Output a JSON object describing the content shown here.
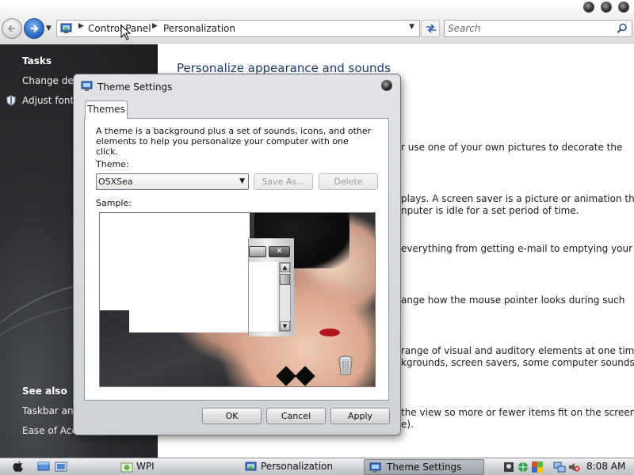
{
  "address_bar": {
    "breadcrumbs": [
      "Control Panel",
      "Personalization"
    ]
  },
  "search": {
    "placeholder": "Search"
  },
  "sidebar": {
    "tasks_heading": "Tasks",
    "tasks": [
      "Change desi",
      "Adjust font s"
    ],
    "see_also_heading": "See also",
    "see_also": [
      "Taskbar and",
      "Ease of Acce"
    ]
  },
  "main": {
    "title": "Personalize appearance and sounds",
    "fragments": [
      "r use one of your own pictures to decorate the",
      "plays. A screen saver is a picture or animation that",
      "nputer is idle for a set period of time.",
      "everything from getting e-mail to emptying your",
      "ange how the mouse pointer looks during such",
      "range of visual and auditory elements at one time",
      "kgrounds, screen savers, some computer sounds, and",
      "the view so more or fewer items fit on the screen.",
      "e)."
    ]
  },
  "dialog": {
    "title": "Theme Settings",
    "tab": "Themes",
    "intro": "A theme is a background plus a set of sounds, icons, and other elements to help you personalize your computer with one click.",
    "theme_label": "Theme:",
    "theme_value": "OSXSea",
    "save_as": "Save As...",
    "delete": "Delete",
    "sample_label": "Sample:",
    "ok": "OK",
    "cancel": "Cancel",
    "apply": "Apply"
  },
  "taskbar": {
    "items": [
      "WPI",
      "Personalization",
      "Theme Settings"
    ],
    "active_item": "Theme Settings",
    "clock": "8:08 AM"
  },
  "colors": {
    "sidebar_bg": "#2c2e31",
    "title_blue": "#1d3b6e",
    "lips": "#b4141b"
  }
}
